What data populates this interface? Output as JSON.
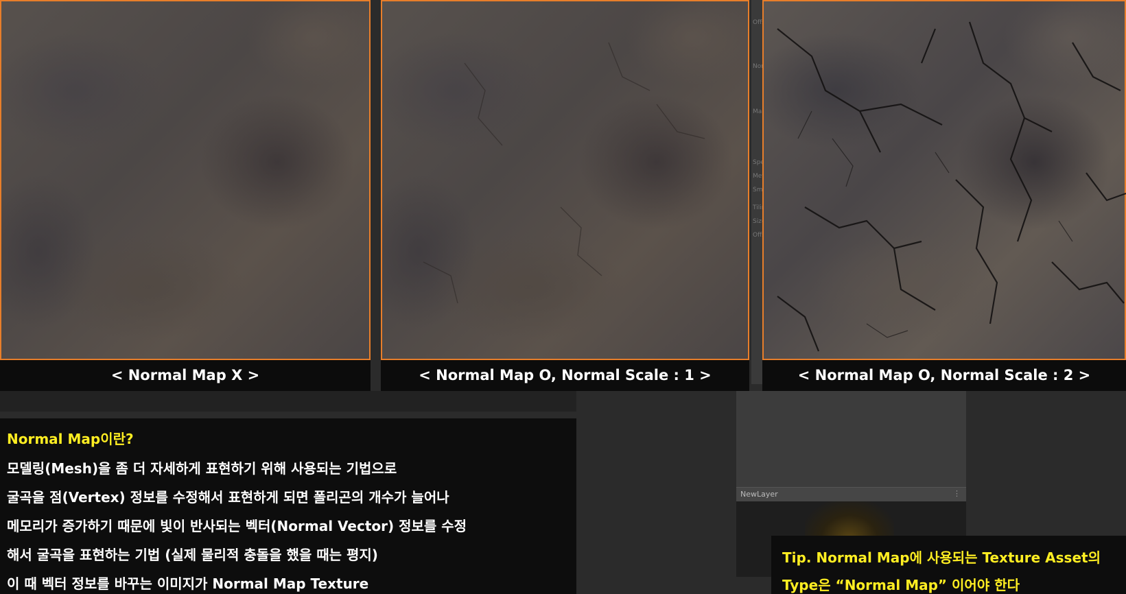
{
  "panels": [
    {
      "caption": "< Normal Map X >"
    },
    {
      "caption": "< Normal Map O, Normal Scale : 1  >"
    },
    {
      "caption": "< Normal Map O, Normal Scale : 2  >"
    }
  ],
  "inspector_strip": {
    "labels": [
      "Offs",
      "Nor",
      "Ma",
      "Spe",
      "Met",
      "Smo",
      "Tilin",
      "Size",
      "Offs"
    ]
  },
  "layer_panel": {
    "label": "NewLayer",
    "menu_glyph": "⋮"
  },
  "explanation": {
    "title": "Normal Map이란?",
    "lines": [
      "모델링(Mesh)을 좀 더 자세하게 표현하기 위해 사용되는 기법으로",
      "굴곡을 점(Vertex) 정보를 수정해서 표현하게 되면 폴리곤의 개수가 늘어나",
      "메모리가 증가하기 때문에 빛이 반사되는 벡터(Normal Vector) 정보를 수정",
      "해서 굴곡을 표현하는 기법 (실제 물리적 충돌을 했을 때는 평지)",
      "이 때 벡터 정보를 바꾸는 이미지가 Normal Map Texture"
    ]
  },
  "tip": {
    "line1": "Tip. Normal Map에 사용되는 Texture Asset의",
    "line2": "Type은 “Normal Map” 이어야 한다"
  },
  "colors": {
    "frame_accent": "#e87e2a",
    "title_yellow": "#ffee22",
    "text_white": "#ffffff"
  }
}
